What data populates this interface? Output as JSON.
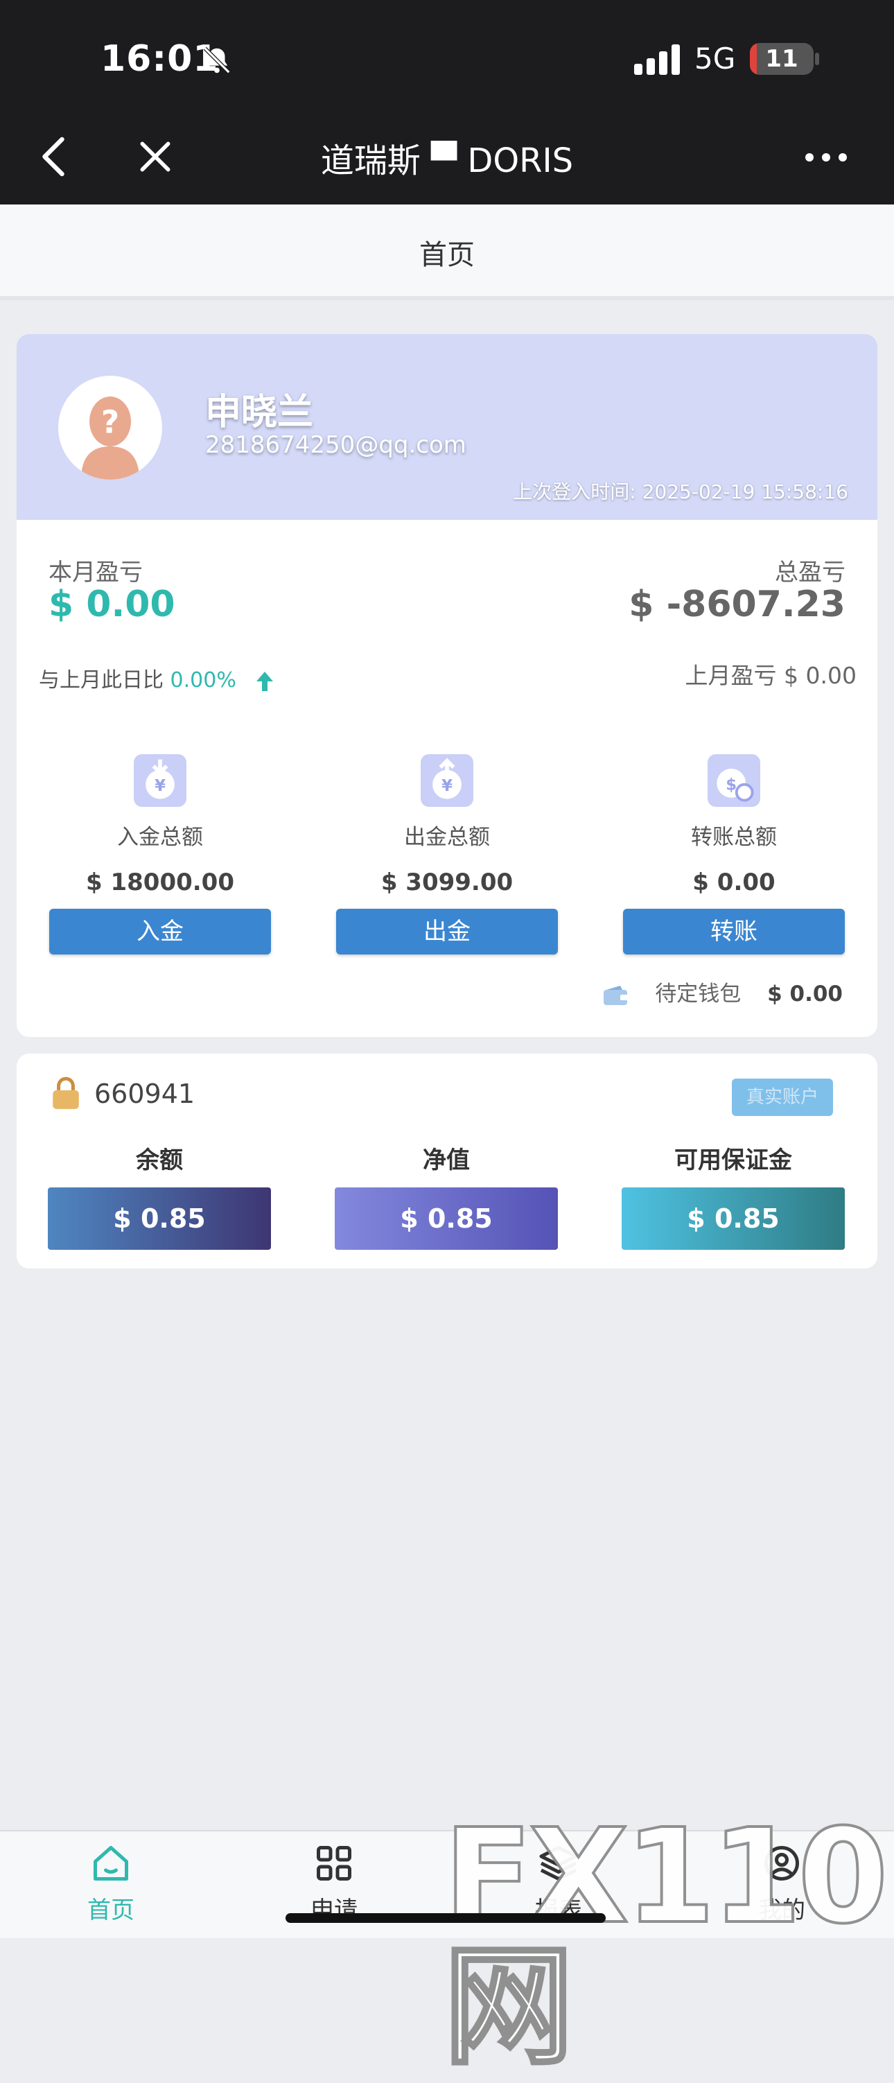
{
  "status_bar": {
    "time": "16:01",
    "network": "5G",
    "battery": "11",
    "battery_level": 0.11
  },
  "nav": {
    "title": "道瑞斯 ▀ DORIS"
  },
  "page_header": {
    "title": "首页"
  },
  "profile": {
    "name": "申晓兰",
    "email": "2818674250@qq.com",
    "last_login": "上次登入时间: 2025-02-19 15:58:16"
  },
  "stats": {
    "month_pl_label": "本月盈亏",
    "month_pl_value": "$ 0.00",
    "total_pl_label": "总盈亏",
    "total_pl_value": "$ -8607.23",
    "compare_label": "与上月此日比",
    "compare_value": "0.00%",
    "last_month_label": "上月盈亏 $ 0.00"
  },
  "funds": [
    {
      "icon": "deposit-icon",
      "label": "入金总额",
      "amount": "$ 18000.00",
      "button": "入金"
    },
    {
      "icon": "withdraw-icon",
      "label": "出金总额",
      "amount": "$ 3099.00",
      "button": "出金"
    },
    {
      "icon": "transfer-icon",
      "label": "转账总额",
      "amount": "$ 0.00",
      "button": "转账"
    }
  ],
  "pending_wallet": {
    "label": "待定钱包",
    "amount": "$ 0.00"
  },
  "account": {
    "number": "660941",
    "badge": "真实账户",
    "metrics": [
      {
        "label": "余额",
        "value": "$ 0.85",
        "color_from": "#4f86c1",
        "color_to": "#3e3673"
      },
      {
        "label": "净值",
        "value": "$ 0.85",
        "color_from": "#8389dd",
        "color_to": "#5553b6"
      },
      {
        "label": "可用保证金",
        "value": "$ 0.85",
        "color_from": "#4fc2e2",
        "color_to": "#2f7c84"
      }
    ]
  },
  "tabbar": [
    {
      "label": "首页",
      "icon": "home-icon",
      "active": true
    },
    {
      "label": "申请",
      "icon": "grid-icon",
      "active": false
    },
    {
      "label": "报表",
      "icon": "layers-icon",
      "active": false
    },
    {
      "label": "我的",
      "icon": "user-icon",
      "active": false
    }
  ],
  "watermark": "FX110网",
  "colors": {
    "accent": "#2fb9ae",
    "button": "#3b86d1",
    "banner": "#d3d9f7"
  }
}
